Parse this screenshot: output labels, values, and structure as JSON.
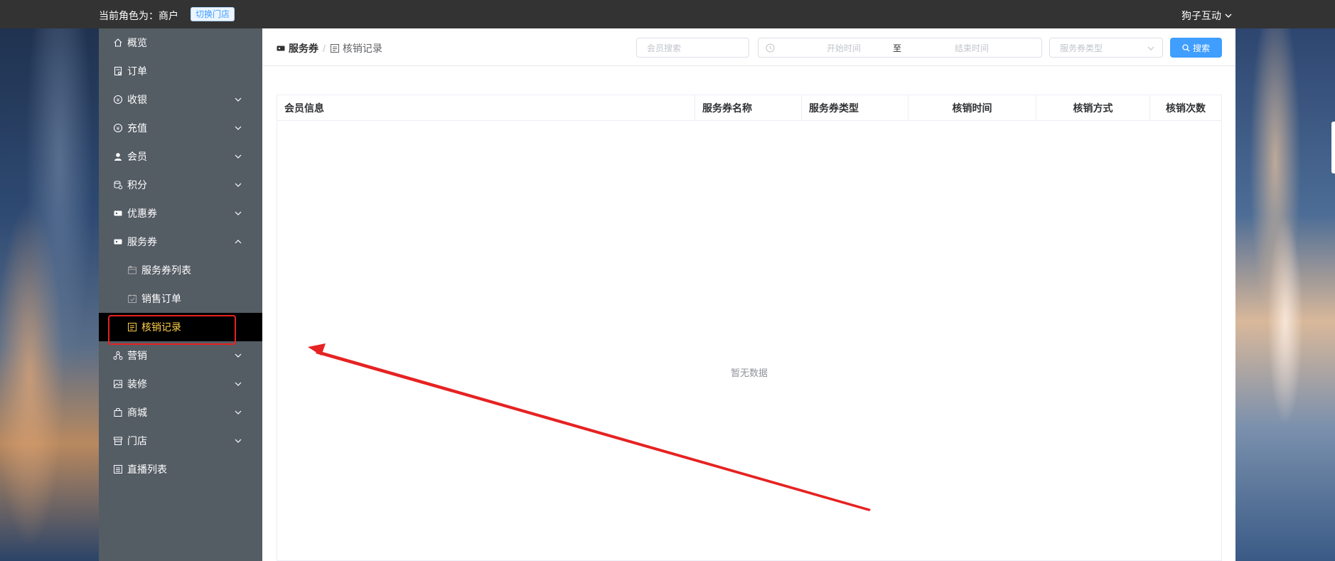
{
  "topbar": {
    "role_text": "当前角色为：商户",
    "switch_store": "切换门店",
    "user_name": "狗子互动"
  },
  "sidebar": {
    "items": [
      {
        "label": "概览",
        "icon": "home-icon"
      },
      {
        "label": "订单",
        "icon": "order-icon"
      },
      {
        "label": "收银",
        "icon": "cashier-icon"
      },
      {
        "label": "充值",
        "icon": "recharge-icon"
      },
      {
        "label": "会员",
        "icon": "member-icon"
      },
      {
        "label": "积分",
        "icon": "points-icon"
      },
      {
        "label": "优惠券",
        "icon": "coupon-icon"
      },
      {
        "label": "服务券",
        "icon": "service-coupon-icon"
      },
      {
        "label": "服务券列表",
        "icon": "list-icon"
      },
      {
        "label": "销售订单",
        "icon": "calendar-check-icon"
      },
      {
        "label": "核销记录",
        "icon": "record-icon"
      },
      {
        "label": "营销",
        "icon": "marketing-icon"
      },
      {
        "label": "装修",
        "icon": "decoration-icon"
      },
      {
        "label": "商城",
        "icon": "mall-icon"
      },
      {
        "label": "门店",
        "icon": "store-icon"
      },
      {
        "label": "直播列表",
        "icon": "live-list-icon"
      }
    ]
  },
  "breadcrumb": {
    "parent": "服务券",
    "current": "核销记录",
    "separator": "/"
  },
  "filters": {
    "member_search_placeholder": "会员搜索",
    "start_time_placeholder": "开始时间",
    "range_separator": "至",
    "end_time_placeholder": "结束时间",
    "type_placeholder": "服务券类型",
    "search_button": "搜索"
  },
  "table": {
    "columns": [
      "会员信息",
      "服务券名称",
      "服务券类型",
      "核销时间",
      "核销方式",
      "核销次数"
    ],
    "rows": [],
    "empty_text": "暂无数据"
  },
  "colors": {
    "topbar": "#333333",
    "sidebar": "#545c64",
    "active_bg": "#000000",
    "active_text": "#ffd04b",
    "primary": "#409eff",
    "annotation": "#e62222"
  }
}
